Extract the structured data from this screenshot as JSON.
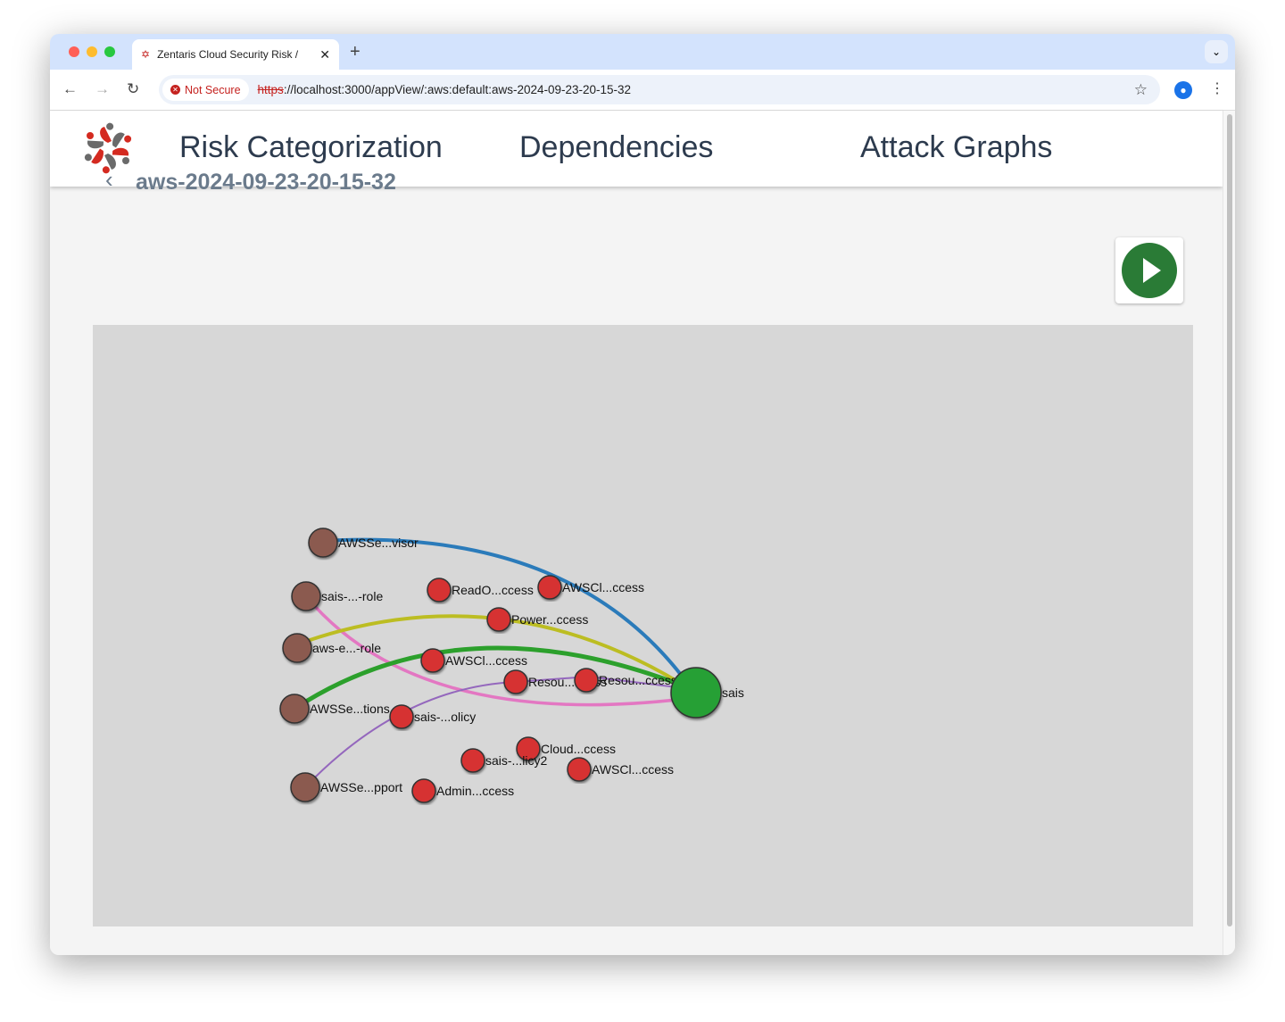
{
  "browser": {
    "tab_title": "Zentaris Cloud Security Risk /",
    "security_label": "Not Secure",
    "url_scheme": "https",
    "url_rest": "://localhost:3000/appView/:aws:default:aws-2024-09-23-20-15-32"
  },
  "nav": {
    "items": [
      "Risk Categorization",
      "Dependencies",
      "Attack Graphs"
    ]
  },
  "page": {
    "title": "aws-2024-09-23-20-15-32"
  },
  "colors": {
    "accent": "#2a7b36",
    "role_node": "#8b5a4f",
    "policy_node": "#d63333",
    "target_node": "#27a035"
  },
  "graph": {
    "nodes": [
      {
        "label": "AWSSe...visor",
        "type": "role"
      },
      {
        "label": "sais-...-role",
        "type": "role"
      },
      {
        "label": "aws-e...-role",
        "type": "role"
      },
      {
        "label": "AWSSe...tions",
        "type": "role"
      },
      {
        "label": "AWSSe...pport",
        "type": "role"
      },
      {
        "label": "ReadO...ccess",
        "type": "policy"
      },
      {
        "label": "AWSCl...ccess",
        "type": "policy"
      },
      {
        "label": "Power...ccess",
        "type": "policy"
      },
      {
        "label": "AWSCl...ccess",
        "type": "policy"
      },
      {
        "label": "Resou...ccess",
        "type": "policy"
      },
      {
        "label": "Resou...ccess",
        "type": "policy"
      },
      {
        "label": "sais-...olicy",
        "type": "policy"
      },
      {
        "label": "Cloud...ccess",
        "type": "policy"
      },
      {
        "label": "sais-...licy2",
        "type": "policy"
      },
      {
        "label": "AWSCl...ccess",
        "type": "policy"
      },
      {
        "label": "Admin...ccess",
        "type": "policy"
      },
      {
        "label": "sais",
        "type": "target"
      }
    ],
    "edges": [
      {
        "from": "AWSSe...visor",
        "to": "sais",
        "color": "#2b7bba"
      },
      {
        "from": "sais-...-role",
        "to": "sais",
        "color": "#e377c2"
      },
      {
        "from": "aws-e...-role",
        "to": "sais",
        "color": "#bcbd22"
      },
      {
        "from": "AWSSe...tions",
        "to": "sais",
        "color": "#2ca02c"
      },
      {
        "from": "AWSSe...pport",
        "to": "sais",
        "color": "#9467bd"
      }
    ]
  }
}
